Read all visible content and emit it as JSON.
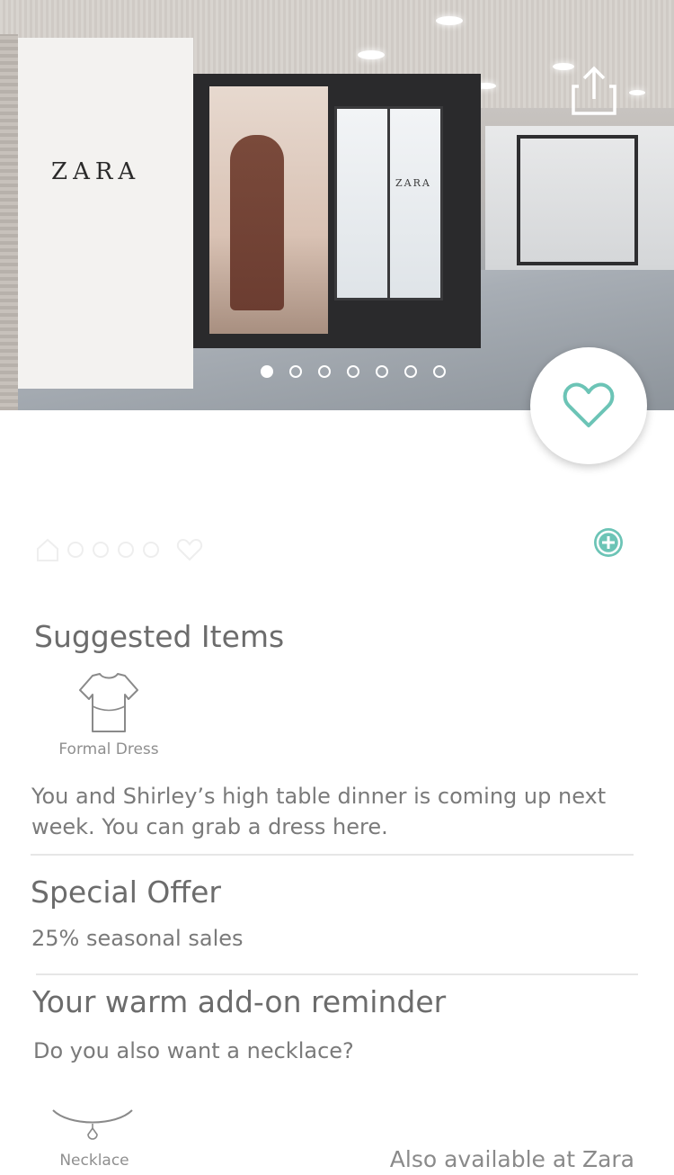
{
  "hero": {
    "store_sign": "ZARA",
    "window_sign": "ZARA",
    "image_count": 7,
    "active_index": 0
  },
  "icons": {
    "share": "share-icon",
    "favorite": "heart-outline-icon",
    "add": "plus-circle-icon",
    "dress": "dress-outline-icon",
    "necklace": "necklace-outline-icon"
  },
  "colors": {
    "accent": "#6cc4b6",
    "text": "#6c6c6c"
  },
  "suggested": {
    "title": "Suggested Items",
    "item_label": "Formal Dress",
    "message": "You and Shirley’s high table dinner is coming up next week. You can grab a dress here."
  },
  "offer": {
    "title": "Special Offer",
    "detail": "25% seasonal sales"
  },
  "reminder": {
    "title": "Your warm add-on reminder",
    "question": "Do you also want a necklace?",
    "item_label": "Necklace",
    "availability": "Also available at Zara"
  }
}
